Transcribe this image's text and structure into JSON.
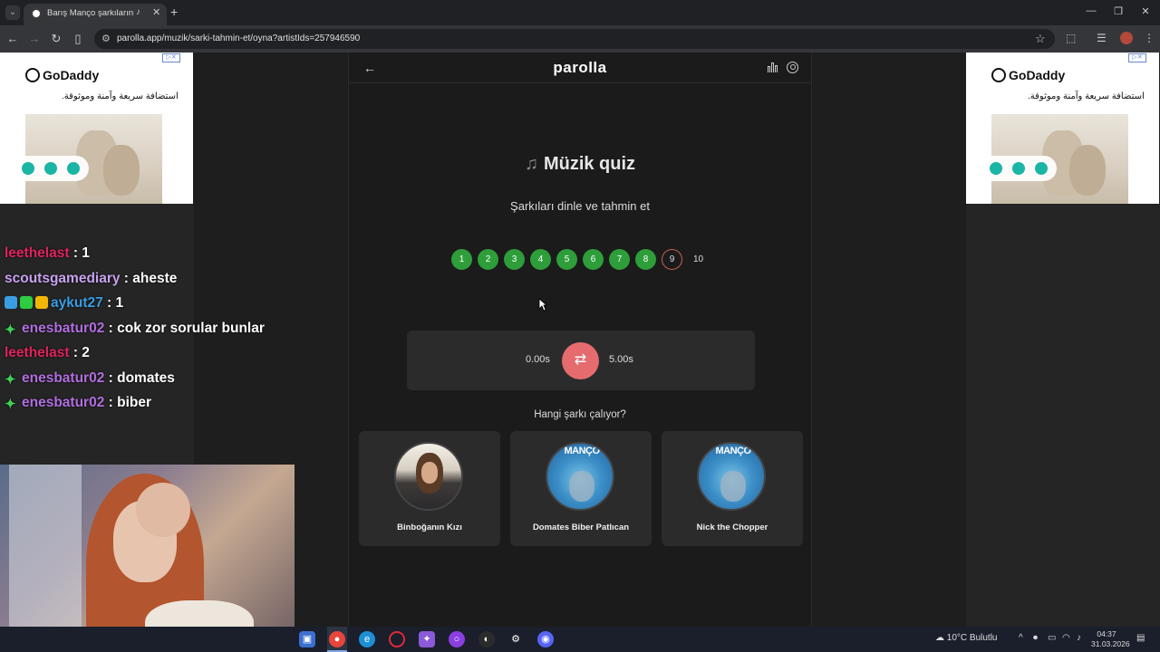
{
  "browser": {
    "tab_title": "Barış Manço şarkılarını din",
    "url": "parolla.app/muzik/sarki-tahmin-et/oyna?artistIds=257946590"
  },
  "ads": {
    "brand": "GoDaddy",
    "tagline": "استضافة سريعة وآمنة وموثوقة."
  },
  "chat": [
    {
      "user": "leethelast",
      "message": " : 1",
      "color": "#e0245e",
      "badge": ""
    },
    {
      "user": "scoutsgamediary",
      "message": " : aheste",
      "color": "#c8a2f0",
      "badge": ""
    },
    {
      "user": "aykut27",
      "message": " : 1",
      "color": "#3a9de3",
      "badge": "multi"
    },
    {
      "user": "enesbatur02",
      "message": " : cok zor sorular bunlar",
      "color": "#b16ee0",
      "badge": "green"
    },
    {
      "user": "leethelast",
      "message": " : 2",
      "color": "#e0245e",
      "badge": ""
    },
    {
      "user": "enesbatur02",
      "message": " : domates",
      "color": "#b16ee0",
      "badge": "green"
    },
    {
      "user": "enesbatur02",
      "message": " : biber",
      "color": "#b16ee0",
      "badge": "green"
    }
  ],
  "app": {
    "logo": "parolla",
    "title": "Müzik quiz",
    "subtitle": "Şarkıları dinle ve tahmin et",
    "steps": [
      {
        "label": "1",
        "state": "done"
      },
      {
        "label": "2",
        "state": "done"
      },
      {
        "label": "3",
        "state": "done"
      },
      {
        "label": "4",
        "state": "done"
      },
      {
        "label": "5",
        "state": "done"
      },
      {
        "label": "6",
        "state": "done"
      },
      {
        "label": "7",
        "state": "done"
      },
      {
        "label": "8",
        "state": "done"
      },
      {
        "label": "9",
        "state": "wrong"
      },
      {
        "label": "10",
        "state": "pending"
      }
    ],
    "player": {
      "start": "0.00s",
      "end": "5.00s"
    },
    "question": "Hangi şarkı çalıyor?",
    "options": [
      {
        "label": "Binboğanın Kızı",
        "art": "man"
      },
      {
        "label": "Domates Biber Patlıcan",
        "art": "blue",
        "band": "MANÇO"
      },
      {
        "label": "Nick the Chopper",
        "art": "blue",
        "band": "MANÇO"
      }
    ],
    "colors": {
      "done": "#2e9e3a",
      "wrong": "#c2624f",
      "accent": "#e56b6f"
    }
  },
  "taskbar": {
    "weather": "10°C  Bulutlu",
    "time": "04:37",
    "date": "31.03.2026"
  }
}
